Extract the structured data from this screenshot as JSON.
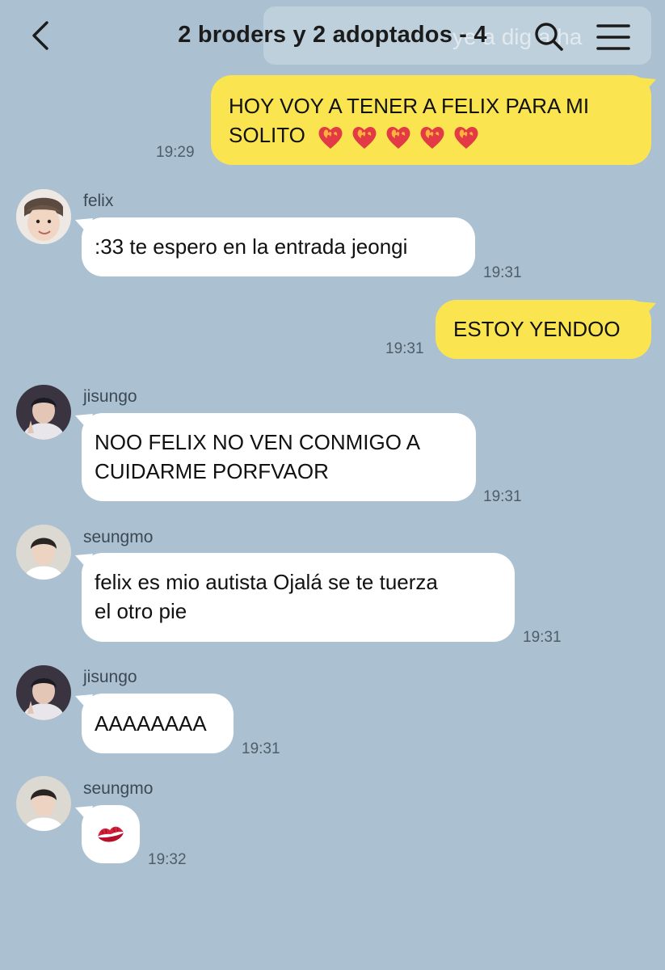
{
  "header": {
    "title": "2 broders y 2 adoptados - 4",
    "search_ghost": "ye a dig a ha"
  },
  "messages": [
    {
      "id": 1,
      "from": "me",
      "text": "HOY VOY A TENER A FELIX PARA MI",
      "text2": "SOLITO",
      "time": "19:29",
      "emoji": "heart-on-fire"
    },
    {
      "id": 2,
      "from": "felix",
      "text": ":33 te espero en la entrada jeongi",
      "time": "19:31"
    },
    {
      "id": 3,
      "from": "me",
      "text": "ESTOY YENDOO",
      "time": "19:31"
    },
    {
      "id": 4,
      "from": "jisungo",
      "text": "NOO FELIX NO VEN CONMIGO A",
      "text2": "CUIDARME PORFVAOR",
      "time": "19:31"
    },
    {
      "id": 5,
      "from": "seungmo",
      "text": "felix es mio autista Ojalá se te tuerza",
      "text2": "el otro pie",
      "time": "19:31"
    },
    {
      "id": 6,
      "from": "jisungo",
      "text": "AAAAAAAA",
      "time": "19:31"
    },
    {
      "id": 7,
      "from": "seungmo",
      "text": "",
      "time": "19:32",
      "emoji": "kiss-mark"
    }
  ],
  "colors": {
    "background": "#abc1d1",
    "my_bubble": "#fae551",
    "their_bubble": "#ffffff"
  }
}
